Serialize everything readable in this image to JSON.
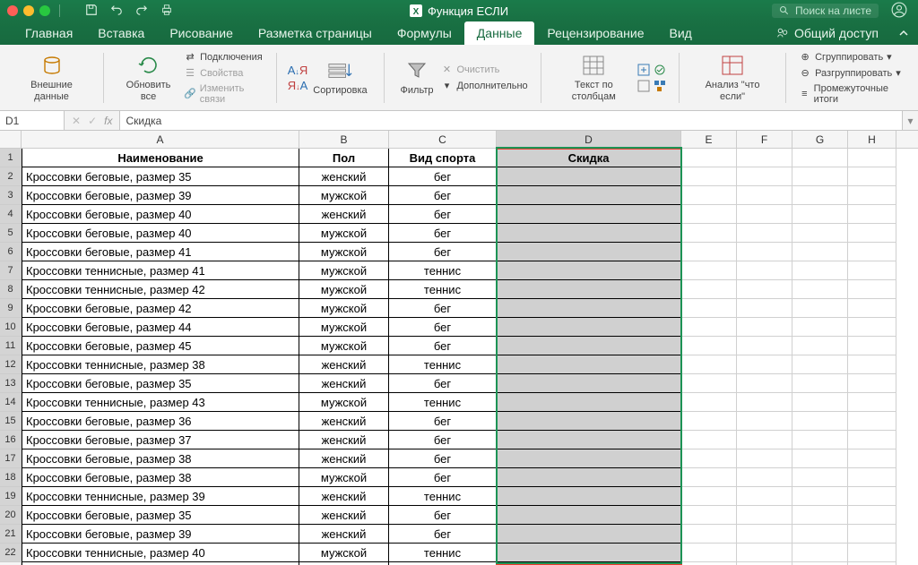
{
  "window": {
    "title": "Функция ЕСЛИ",
    "search_placeholder": "Поиск на листе"
  },
  "tabs": {
    "items": [
      "Главная",
      "Вставка",
      "Рисование",
      "Разметка страницы",
      "Формулы",
      "Данные",
      "Рецензирование",
      "Вид"
    ],
    "active": 5,
    "share": "Общий доступ"
  },
  "ribbon": {
    "external": "Внешние данные",
    "refresh": "Обновить все",
    "connections": "Подключения",
    "properties": "Свойства",
    "edit_links": "Изменить связи",
    "sort_az": "А↓Я",
    "sort_za": "А↓Я",
    "sort_btn": "Сортировка",
    "filter": "Фильтр",
    "clear": "Очистить",
    "advanced": "Дополнительно",
    "text_to_cols": "Текст по столбцам",
    "whatif": "Анализ \"что если\"",
    "group": "Сгруппировать",
    "ungroup": "Разгруппировать",
    "subtotal": "Промежуточные итоги"
  },
  "formula_bar": {
    "name_box": "D1",
    "formula": "Скидка",
    "fx": "fx"
  },
  "columns": [
    "A",
    "B",
    "C",
    "D",
    "E",
    "F",
    "G",
    "H"
  ],
  "headers": {
    "a": "Наименование",
    "b": "Пол",
    "c": "Вид спорта",
    "d": "Скидка"
  },
  "rows": [
    {
      "n": 2,
      "a": "Кроссовки беговые, размер 35",
      "b": "женский",
      "c": "бег"
    },
    {
      "n": 3,
      "a": "Кроссовки беговые, размер 39",
      "b": "мужской",
      "c": "бег"
    },
    {
      "n": 4,
      "a": "Кроссовки беговые, размер 40",
      "b": "женский",
      "c": "бег"
    },
    {
      "n": 5,
      "a": "Кроссовки беговые, размер 40",
      "b": "мужской",
      "c": "бег"
    },
    {
      "n": 6,
      "a": "Кроссовки беговые, размер 41",
      "b": "мужской",
      "c": "бег"
    },
    {
      "n": 7,
      "a": "Кроссовки теннисные, размер 41",
      "b": "мужской",
      "c": "теннис"
    },
    {
      "n": 8,
      "a": "Кроссовки теннисные, размер 42",
      "b": "мужской",
      "c": "теннис"
    },
    {
      "n": 9,
      "a": "Кроссовки беговые, размер 42",
      "b": "мужской",
      "c": "бег"
    },
    {
      "n": 10,
      "a": "Кроссовки беговые, размер 44",
      "b": "мужской",
      "c": "бег"
    },
    {
      "n": 11,
      "a": "Кроссовки беговые, размер 45",
      "b": "мужской",
      "c": "бег"
    },
    {
      "n": 12,
      "a": "Кроссовки теннисные, размер 38",
      "b": "женский",
      "c": "теннис"
    },
    {
      "n": 13,
      "a": "Кроссовки беговые, размер 35",
      "b": "женский",
      "c": "бег"
    },
    {
      "n": 14,
      "a": "Кроссовки теннисные, размер 43",
      "b": "мужской",
      "c": "теннис"
    },
    {
      "n": 15,
      "a": "Кроссовки беговые, размер 36",
      "b": "женский",
      "c": "бег"
    },
    {
      "n": 16,
      "a": "Кроссовки беговые, размер 37",
      "b": "женский",
      "c": "бег"
    },
    {
      "n": 17,
      "a": "Кроссовки беговые, размер 38",
      "b": "женский",
      "c": "бег"
    },
    {
      "n": 18,
      "a": "Кроссовки беговые, размер 38",
      "b": "мужской",
      "c": "бег"
    },
    {
      "n": 19,
      "a": "Кроссовки теннисные, размер 39",
      "b": "женский",
      "c": "теннис"
    },
    {
      "n": 20,
      "a": "Кроссовки беговые, размер 35",
      "b": "женский",
      "c": "бег"
    },
    {
      "n": 21,
      "a": "Кроссовки беговые, размер 39",
      "b": "женский",
      "c": "бег"
    },
    {
      "n": 22,
      "a": "Кроссовки теннисные, размер 40",
      "b": "мужской",
      "c": "теннис"
    }
  ]
}
